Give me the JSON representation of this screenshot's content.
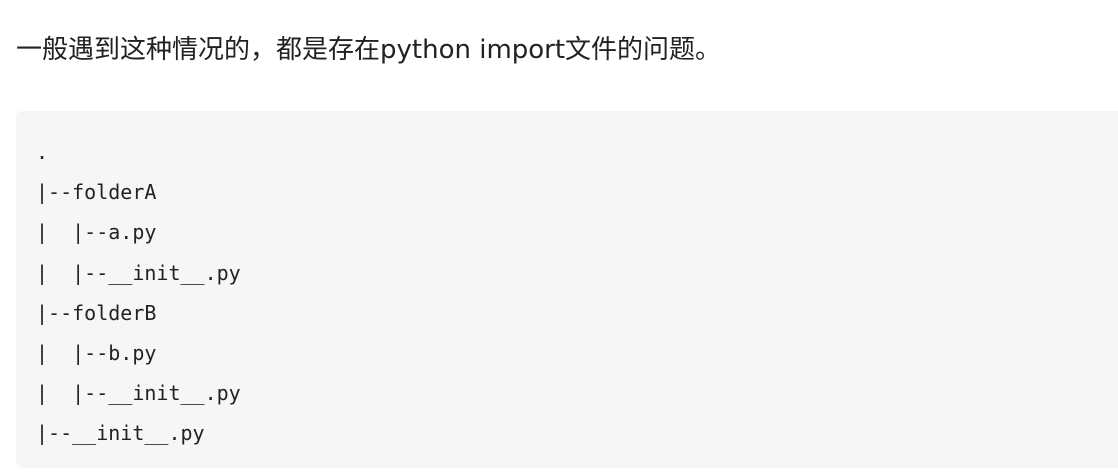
{
  "paragraph": {
    "text": "一般遇到这种情况的，都是存在python import文件的问题。"
  },
  "code_block": {
    "lines": [
      ".",
      "|--folderA",
      "|  |--a.py",
      "|  |--__init__.py",
      "|--folderB",
      "|  |--b.py",
      "|  |--__init__.py",
      "|--__init__.py"
    ]
  }
}
